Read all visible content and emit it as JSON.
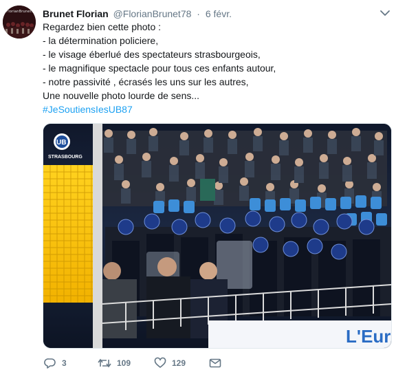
{
  "tweet": {
    "author": {
      "name": "Brunet Florian",
      "handle": "@FlorianBrunet78",
      "avatar_caption": "@FlorianBrunet78"
    },
    "separator": "·",
    "date": "6 févr.",
    "lines": [
      "Regardez bien cette photo :",
      "- la détermination policiere,",
      "- le visage éberlué des spectateurs strasbourgeois,",
      "- le magnifique spectacle pour tous ces enfants autour,",
      "- notre passivité , écrasés les uns sur les autres,",
      "Une nouvelle photo lourde de sens..."
    ],
    "hashtag": "#JeSoutiensIesUB87",
    "media": {
      "logo_top": "UB",
      "logo_bottom": "STRASBOURG",
      "banner_text": "L'Euro"
    },
    "actions": {
      "replies": "3",
      "retweets": "109",
      "likes": "129"
    }
  },
  "colors": {
    "link": "#1da1f2",
    "secondary_text": "#657786",
    "primary_text": "#14171a"
  },
  "icons": [
    "chevron-down-icon",
    "reply-icon",
    "retweet-icon",
    "like-icon",
    "direct-message-icon"
  ]
}
